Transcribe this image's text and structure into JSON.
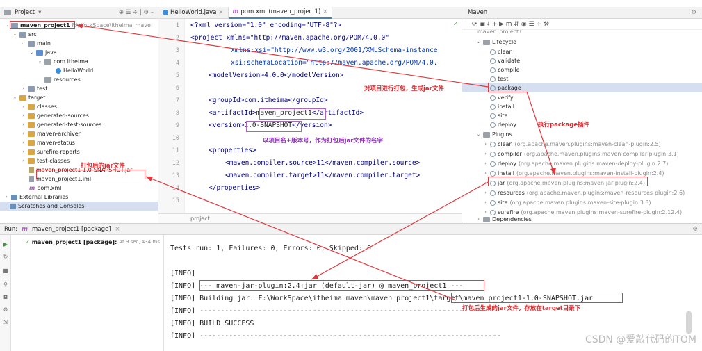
{
  "project_panel": {
    "title": "Project",
    "tree": [
      {
        "label": "maven_project1",
        "extra": "F:\\WorkSpace\\itheima_mave",
        "bold": true
      },
      {
        "label": "src"
      },
      {
        "label": "main"
      },
      {
        "label": "java"
      },
      {
        "label": "com.itheima"
      },
      {
        "label": "HelloWorld"
      },
      {
        "label": "resources"
      },
      {
        "label": "test"
      },
      {
        "label": "target"
      },
      {
        "label": "classes"
      },
      {
        "label": "generated-sources"
      },
      {
        "label": "generated-test-sources"
      },
      {
        "label": "maven-archiver"
      },
      {
        "label": "maven-status"
      },
      {
        "label": "surefire-reports"
      },
      {
        "label": "test-classes"
      },
      {
        "label": "maven_project1-1.0-SNAPSHOT.jar"
      },
      {
        "label": "maven_project1.iml"
      },
      {
        "label": "pom.xml"
      },
      {
        "label": "External Libraries"
      },
      {
        "label": "Scratches and Consoles"
      }
    ]
  },
  "tabs": [
    {
      "label": "HelloWorld.java"
    },
    {
      "label": "pom.xml (maven_project1)"
    }
  ],
  "editor": {
    "lines": [
      "1",
      "2",
      "3",
      "4",
      "5",
      "6",
      "7",
      "8",
      "9",
      "10",
      "11",
      "12",
      "13",
      "14",
      "15"
    ],
    "breadcrumb": "project",
    "code": {
      "l1": "<?xml version=\"1.0\" encoding=\"UTF-8\"?>",
      "l2": "<project xmlns=\"http://maven.apache.org/POM/4.0.0\"",
      "l3": "xmlns:xsi=\"http://www.w3.org/2001/XMLSchema-instance",
      "l4": "xsi:schemaLocation=\"http://maven.apache.org/POM/4.0.",
      "l5": "<modelVersion>4.0.0</modelVersion>",
      "l7": "<groupId>com.itheima</groupId>",
      "l8a": "<artifactId>",
      "l8b": "maven_project1",
      "l8c": "</artifactId>",
      "l9a": "<version>",
      "l9b": "1.0-SNAPSHOT",
      "l9c": "</version>",
      "l11": "<properties>",
      "l12": "<maven.compiler.source>11</maven.compiler.source>",
      "l13": "<maven.compiler.target>11</maven.compiler.target>",
      "l14": "</properties>"
    }
  },
  "maven_panel": {
    "title": "Maven",
    "toolbar": "⟳ ▣ ⤓ + ▶ m ⇵ ◉ ☰ ÷ ⚒",
    "clipped": "maven_project1",
    "lifecycle": "Lifecycle",
    "lifecycle_items": [
      "clean",
      "validate",
      "compile",
      "test",
      "package",
      "verify",
      "install",
      "site",
      "deploy"
    ],
    "plugins": "Plugins",
    "plugin_items": [
      {
        "name": "clean",
        "desc": "(org.apache.maven.plugins:maven-clean-plugin:2.5)"
      },
      {
        "name": "compiler",
        "desc": "(org.apache.maven.plugins:maven-compiler-plugin:3.1)"
      },
      {
        "name": "deploy",
        "desc": "(org.apache.maven.plugins:maven-deploy-plugin:2.7)"
      },
      {
        "name": "install",
        "desc": "(org.apache.maven.plugins:maven-install-plugin:2.4)"
      },
      {
        "name": "jar",
        "desc": "(org.apache.maven.plugins:maven-jar-plugin:2.4)"
      },
      {
        "name": "resources",
        "desc": "(org.apache.maven.plugins:maven-resources-plugin:2.6)"
      },
      {
        "name": "site",
        "desc": "(org.apache.maven.plugins:maven-site-plugin:3.3)"
      },
      {
        "name": "surefire",
        "desc": "(org.apache.maven.plugins:maven-surefire-plugin:2.12.4)"
      }
    ],
    "dependencies": "Dependencies"
  },
  "run_panel": {
    "label": "Run:",
    "tab": "maven_project1 [package]",
    "tree_item": "maven_project1 [package]:",
    "tree_time": "At 9 sec, 434 ms",
    "console": [
      "Tests run: 1, Failures: 0, Errors: 0, Skipped: 0",
      "",
      "[INFO]",
      "[INFO] --- maven-jar-plugin:2.4:jar (default-jar) @ maven_project1 ---",
      "[INFO] Building jar: F:\\WorkSpace\\itheima_maven\\maven_project1\\target\\maven_project1-1.0-SNAPSHOT.jar",
      "[INFO] ------------------------------------------------------------------------",
      "[INFO] BUILD SUCCESS",
      "[INFO] ------------------------------------------------------------------------"
    ]
  },
  "annotations": {
    "a1": "对项目进行打包，生成jar文件",
    "a2": "执行package插件",
    "a3": "打包后的jar文件",
    "a4": "以项目名+版本号，作为打包后jar文件的名字",
    "a5": "打包后生成的jar文件，存放在target目录下"
  },
  "watermark": "CSDN @爱敲代码的TOM",
  "colors": {
    "red": "#e0393e",
    "purple": "#b060c8",
    "selection": "#d5dff0"
  }
}
